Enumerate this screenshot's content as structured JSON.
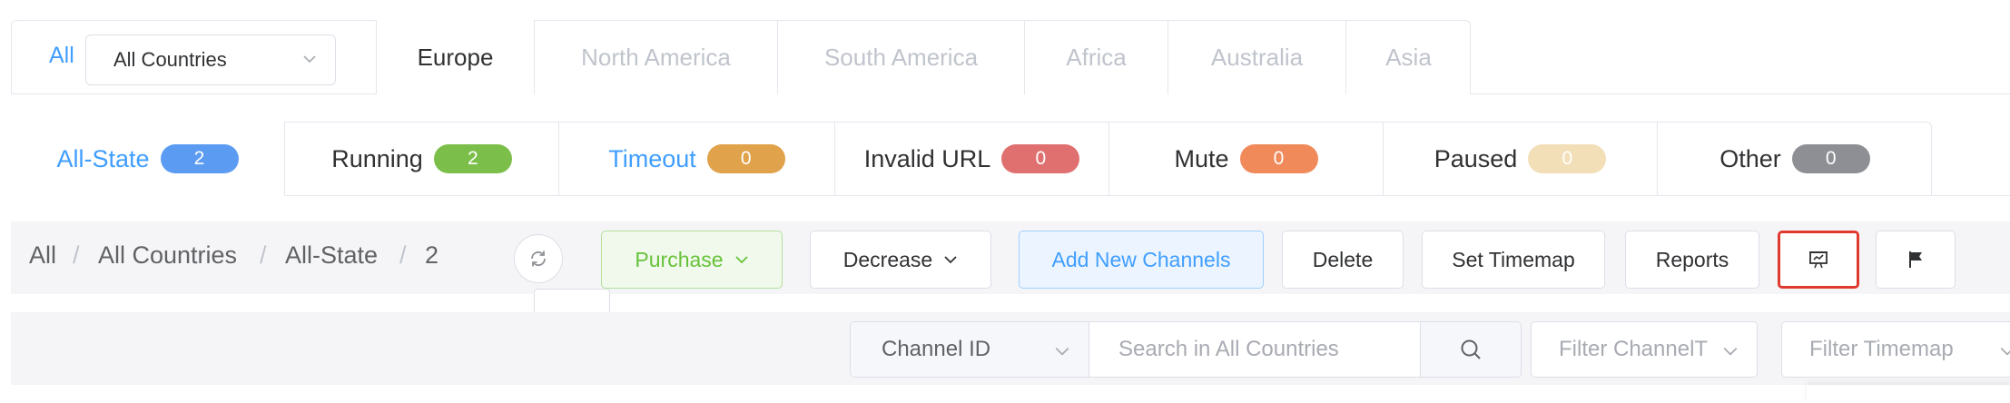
{
  "regions": {
    "all_label": "All",
    "country_select": "All Countries",
    "tabs": [
      "Europe",
      "North America",
      "South America",
      "Africa",
      "Australia",
      "Asia"
    ]
  },
  "states": [
    {
      "label": "All-State",
      "count": "2",
      "color": "#5b9cf2"
    },
    {
      "label": "Running",
      "count": "2",
      "color": "#7bbf4a"
    },
    {
      "label": "Timeout",
      "count": "0",
      "color": "#e0a24a"
    },
    {
      "label": "Invalid URL",
      "count": "0",
      "color": "#e06f6f"
    },
    {
      "label": "Mute",
      "count": "0",
      "color": "#f08a5a"
    },
    {
      "label": "Paused",
      "count": "0",
      "color": "#f2dfb8"
    },
    {
      "label": "Other",
      "count": "0",
      "color": "#8e8f94"
    }
  ],
  "breadcrumb": [
    "All",
    "All Countries",
    "All-State",
    "2"
  ],
  "breadcrumb_sep": "/",
  "toolbar": {
    "purchase": "Purchase",
    "decrease": "Decrease",
    "add_channels": "Add New Channels",
    "delete": "Delete",
    "set_timemap": "Set Timemap",
    "reports": "Reports"
  },
  "filters": {
    "field_select": "Channel ID",
    "search_placeholder": "Search in All Countries",
    "channel_type_placeholder": "Filter ChannelT",
    "timemap_placeholder": "Filter Timemap"
  }
}
